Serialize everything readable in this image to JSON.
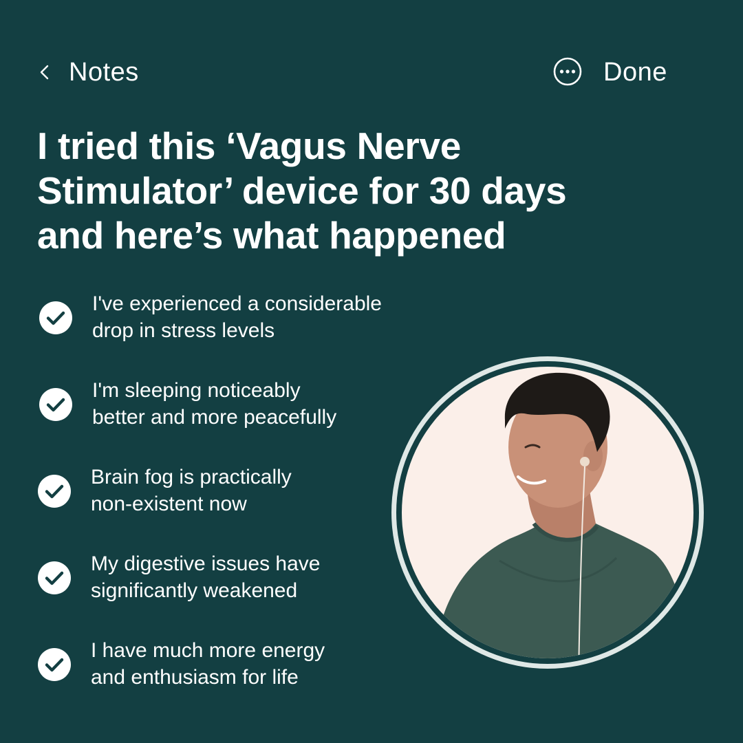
{
  "nav": {
    "back_icon": "chevron-left-icon",
    "back_label": "Notes",
    "more_icon": "ellipsis-circle-icon",
    "done_label": "Done"
  },
  "headline": {
    "lines": [
      "I tried this ‘Vagus Nerve",
      "Stimulator’ device for 30 days",
      "and here’s what happened"
    ]
  },
  "benefits": [
    {
      "icon": "check-circle-icon",
      "lines": [
        "I've experienced a considerable",
        "drop in stress levels"
      ]
    },
    {
      "icon": "check-circle-icon",
      "lines": [
        "I'm sleeping noticeably",
        "better and more peacefully"
      ]
    },
    {
      "icon": "check-circle-icon",
      "lines": [
        "Brain fog is practically",
        "non-existent now"
      ]
    },
    {
      "icon": "check-circle-icon",
      "lines": [
        "My digestive issues have",
        "significantly weakened"
      ]
    },
    {
      "icon": "check-circle-icon",
      "lines": [
        "I have much more energy",
        "and enthusiasm for life"
      ]
    }
  ],
  "colors": {
    "background": "#133f42",
    "text": "#ffffff",
    "photo_ring": "#dfe8e6",
    "photo_background": "#fbefe9",
    "shirt": "#3c5a52",
    "hair": "#1e1a17",
    "skin": "#c99178"
  }
}
